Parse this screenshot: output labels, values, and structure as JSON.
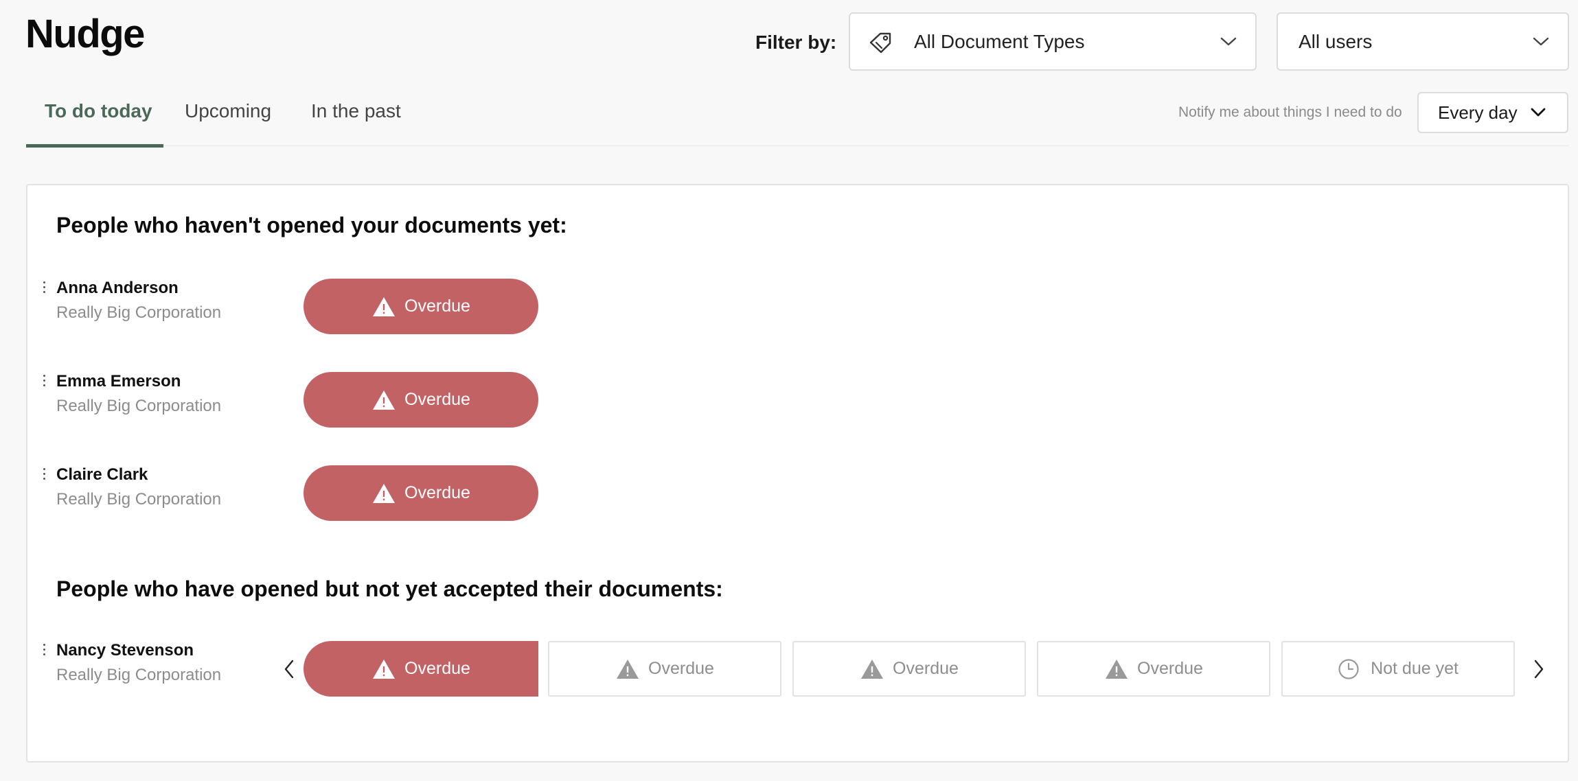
{
  "header": {
    "title": "Nudge",
    "filter_label": "Filter by:"
  },
  "filters": {
    "document_type": {
      "value": "All Document Types",
      "icon": "tag-icon"
    },
    "users": {
      "value": "All users"
    }
  },
  "tabs": [
    {
      "label": "To do today",
      "active": true
    },
    {
      "label": "Upcoming",
      "active": false
    },
    {
      "label": "In the past",
      "active": false
    }
  ],
  "notify": {
    "label": "Notify me about things I need to do",
    "frequency": "Every day"
  },
  "colors": {
    "accent": "#4a6a58",
    "overdue": "#c26265"
  },
  "sections": {
    "not_opened": {
      "heading": "People who haven't opened your documents yet:",
      "people": [
        {
          "name": "Anna Anderson",
          "company": "Really Big Corporation",
          "status": "Overdue"
        },
        {
          "name": "Emma Emerson",
          "company": "Really Big Corporation",
          "status": "Overdue"
        },
        {
          "name": "Claire Clark",
          "company": "Really Big Corporation",
          "status": "Overdue"
        }
      ]
    },
    "opened_not_accepted": {
      "heading": "People who have opened but not yet accepted their documents:",
      "people": [
        {
          "name": "Nancy Stevenson",
          "company": "Really Big Corporation",
          "steps": [
            {
              "label": "Overdue",
              "icon": "warning-icon",
              "active": true
            },
            {
              "label": "Overdue",
              "icon": "warning-icon",
              "active": false
            },
            {
              "label": "Overdue",
              "icon": "warning-icon",
              "active": false
            },
            {
              "label": "Overdue",
              "icon": "warning-icon",
              "active": false
            },
            {
              "label": "Not due yet",
              "icon": "clock-icon",
              "active": false
            }
          ]
        }
      ]
    }
  }
}
